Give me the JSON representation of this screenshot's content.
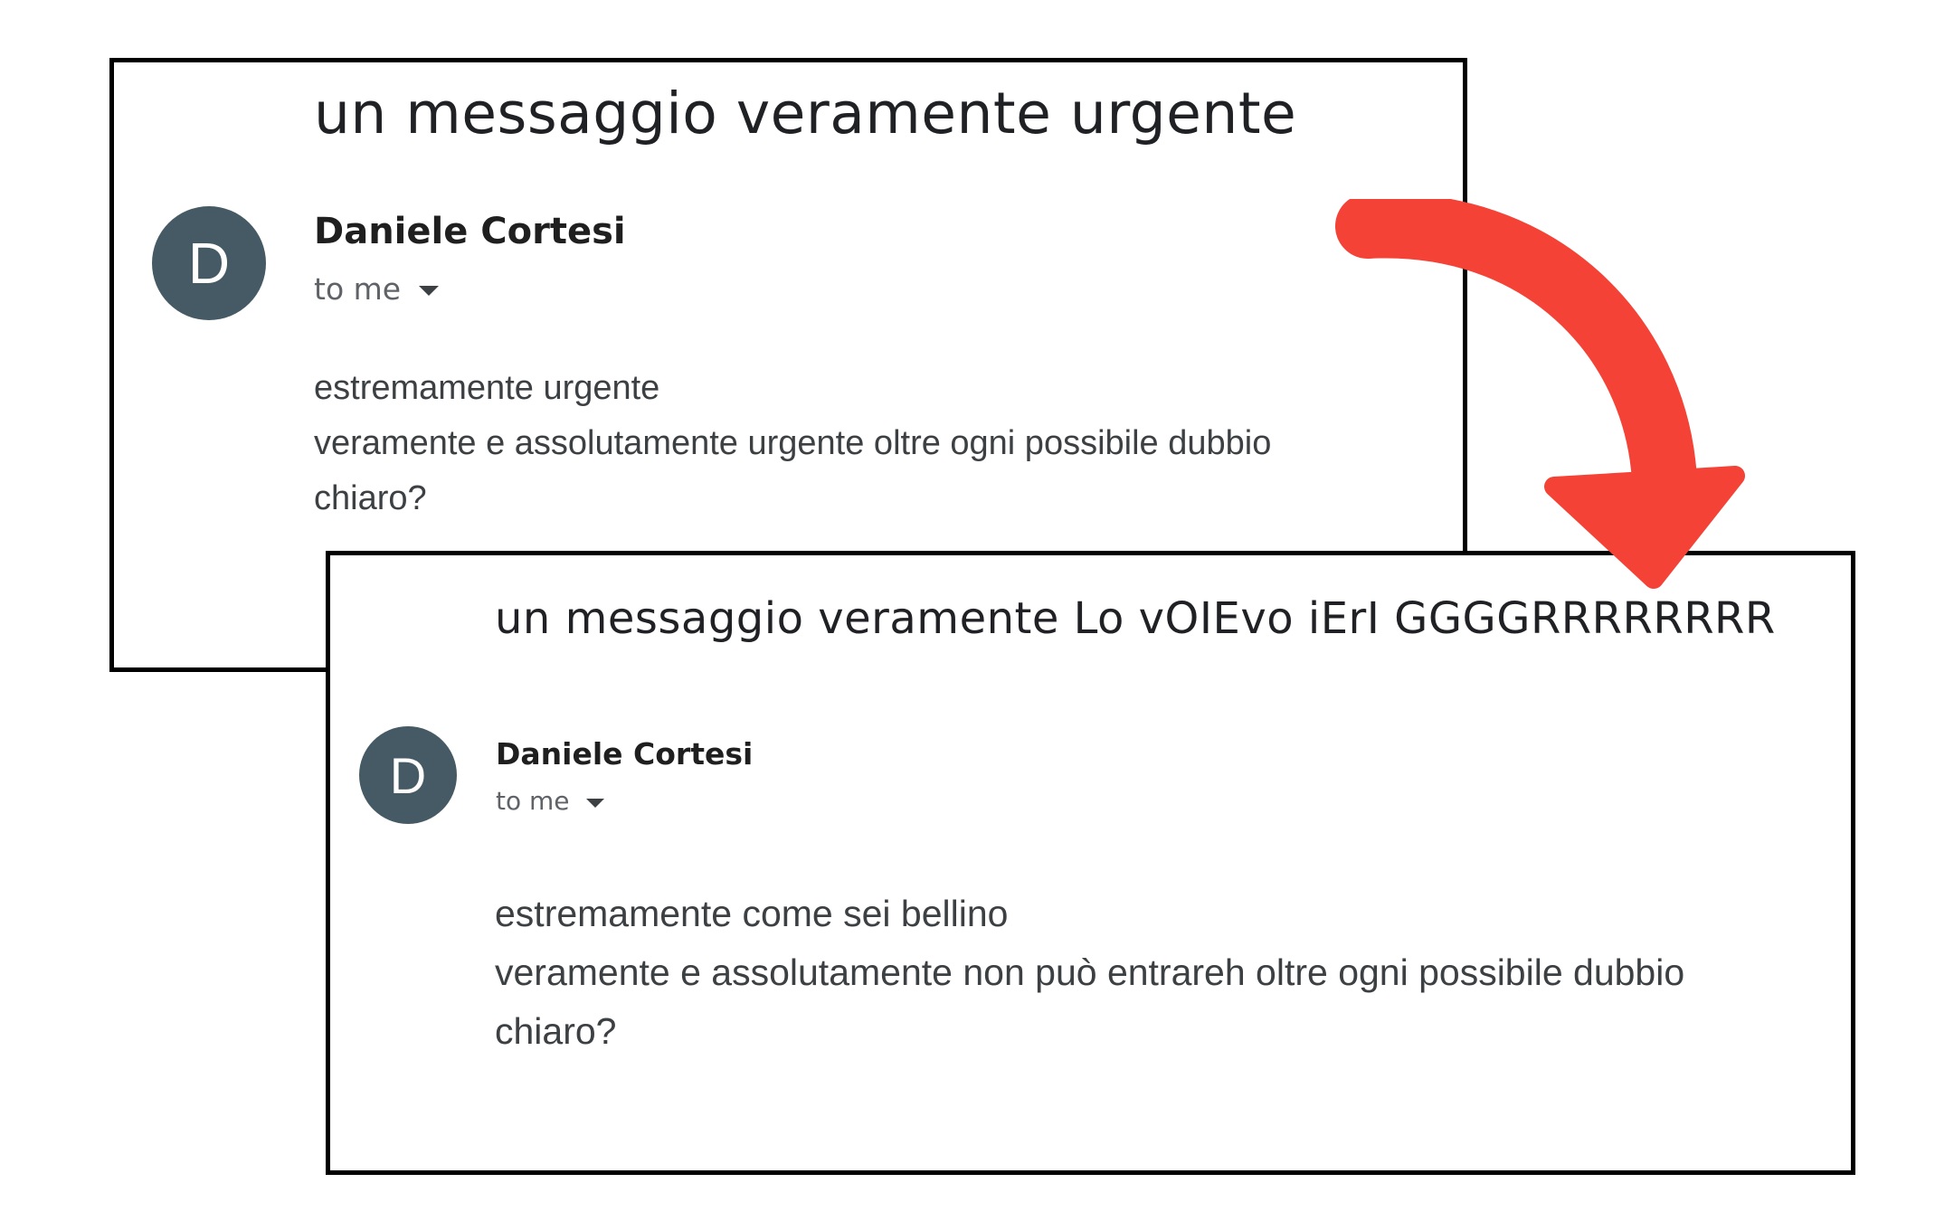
{
  "original_email": {
    "subject": "un messaggio veramente urgente",
    "avatar_letter": "D",
    "sender": "Daniele Cortesi",
    "recipient": "to me",
    "body_lines": [
      "estremamente urgente",
      "veramente e assolutamente urgente oltre ogni possibile dubbio",
      "chiaro?"
    ]
  },
  "modified_email": {
    "subject": "un messaggio veramente Lo vOIEvo iErI GGGGRRRRRRRR",
    "avatar_letter": "D",
    "sender": "Daniele Cortesi",
    "recipient": "to me",
    "body_lines": [
      "estremamente come sei bellino",
      "veramente e assolutamente non può entrareh oltre ogni possibile dubbio",
      "chiaro?"
    ]
  },
  "colors": {
    "arrow": "#f44336",
    "avatar": "#455a64",
    "frame": "#000000"
  },
  "icons": {
    "transition": "curved-arrow-icon",
    "details_toggle": "caret-down-icon"
  }
}
